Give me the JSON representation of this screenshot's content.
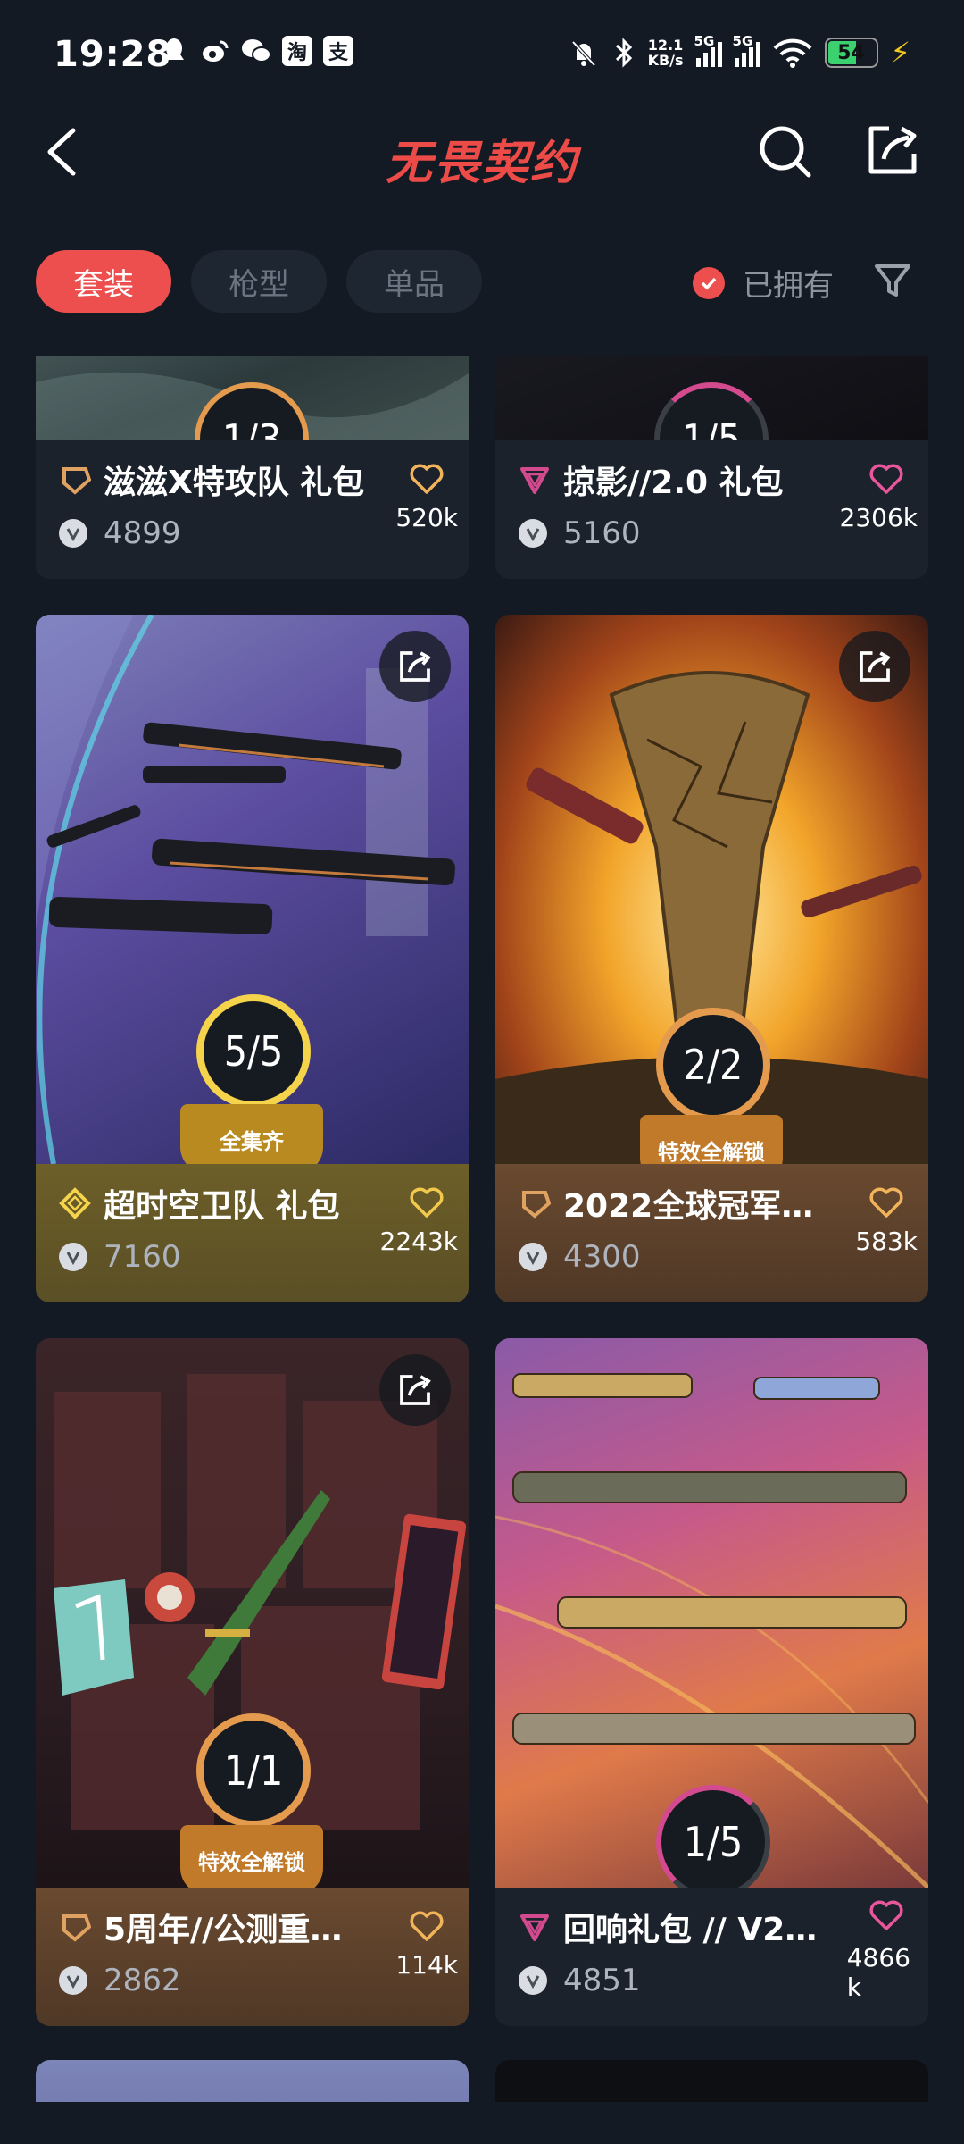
{
  "status_bar": {
    "time": "19:28",
    "net_speed_value": "12.1",
    "net_speed_unit": "KB/s",
    "sim1": "5G",
    "sim2": "5G",
    "battery": "54",
    "app_icons": [
      "qq-icon",
      "weibo-icon",
      "wechat-icon",
      "taobao-icon",
      "alipay-icon"
    ],
    "taobao_glyph": "淘",
    "alipay_glyph": "支"
  },
  "header": {
    "title": "无畏契约"
  },
  "tabs": [
    {
      "label": "套装",
      "active": true
    },
    {
      "label": "枪型",
      "active": false
    },
    {
      "label": "单品",
      "active": false
    }
  ],
  "owned_filter": {
    "label": "已拥有",
    "checked": true
  },
  "cards": [
    {
      "name": "滋滋X特攻队 礼包",
      "price": "4899",
      "likes": "520k",
      "progress": "1/3",
      "rarity": "premium",
      "rarity_color": "#e0a260",
      "heart_color": "#f2b45a",
      "banner": ""
    },
    {
      "name": "掠影//2.0 礼包",
      "price": "5160",
      "likes": "2306k",
      "progress": "1/5",
      "rarity": "exclusive",
      "rarity_color": "#d44a8f",
      "heart_color": "#e9569b",
      "banner": ""
    },
    {
      "name": "超时空卫队 礼包",
      "price": "7160",
      "likes": "2243k",
      "progress": "5/5",
      "rarity": "ultra",
      "rarity_color": "#f5d44c",
      "heart_color": "#f2c94c",
      "banner": "全集齐"
    },
    {
      "name": "2022全球冠军…",
      "price": "4300",
      "likes": "583k",
      "progress": "2/2",
      "rarity": "premium",
      "rarity_color": "#e0a260",
      "heart_color": "#f2b45a",
      "banner": "特效全解锁"
    },
    {
      "name": "5周年//公测重…",
      "price": "2862",
      "likes": "114k",
      "progress": "1/1",
      "rarity": "premium",
      "rarity_color": "#e0a260",
      "heart_color": "#f2b45a",
      "banner": "特效全解锁"
    },
    {
      "name": "回响礼包 // V2…",
      "price": "4851",
      "likes": "4866\nk",
      "progress": "1/5",
      "rarity": "exclusive",
      "rarity_color": "#d44a8f",
      "heart_color": "#e9569b",
      "banner": ""
    }
  ]
}
